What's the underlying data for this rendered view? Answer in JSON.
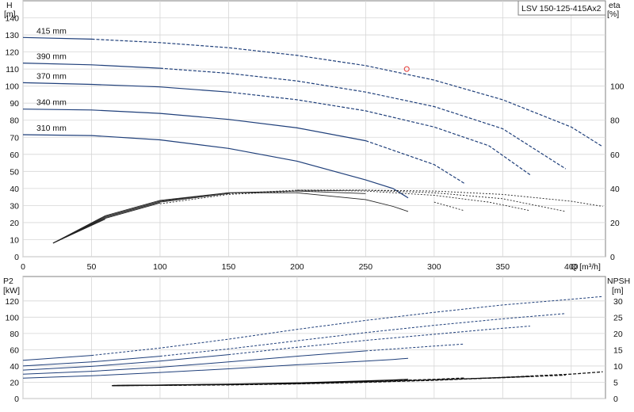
{
  "title_box": {
    "text": "LSV 150-125-415Ax2"
  },
  "colors": {
    "curve": "#1f3f7a",
    "efficiency": "#222222",
    "npsh": "#111111",
    "marker": "#e53935",
    "grid": "#d6d6d6",
    "frame": "#808080"
  },
  "chart_data": [
    {
      "type": "line",
      "panel": "head",
      "xlabel": "Q [m³/h]",
      "ylabel": "H",
      "ylabel_unit": "[m]",
      "y2label": "eta",
      "y2label_unit": "[%]",
      "xlim": [
        0,
        425
      ],
      "ylim": [
        0,
        150
      ],
      "y2lim": [
        0,
        150
      ],
      "xticks": [
        0,
        50,
        100,
        150,
        200,
        250,
        300,
        350,
        400
      ],
      "yticks": [
        0,
        10,
        20,
        30,
        40,
        50,
        60,
        70,
        80,
        90,
        100,
        110,
        120,
        130,
        140
      ],
      "y2ticks": [
        0,
        20,
        40,
        60,
        80,
        100
      ],
      "grid": true,
      "series": [
        {
          "name": "415 mm",
          "x": [
            0,
            50,
            100,
            150,
            200,
            250,
            300,
            350,
            400,
            423
          ],
          "y": [
            128.5,
            127.5,
            125.5,
            122.5,
            118,
            112,
            103.5,
            92,
            76,
            64.5
          ]
        },
        {
          "name": "390 mm",
          "x": [
            0,
            50,
            100,
            150,
            200,
            250,
            300,
            350,
            396
          ],
          "y": [
            113.5,
            112.5,
            110.5,
            107.5,
            103,
            96.5,
            88,
            75,
            51.5
          ]
        },
        {
          "name": "370 mm",
          "x": [
            0,
            50,
            100,
            150,
            200,
            250,
            300,
            340,
            370
          ],
          "y": [
            102,
            101,
            99.5,
            96.5,
            92,
            85.5,
            76,
            65,
            48
          ]
        },
        {
          "name": "340 mm",
          "x": [
            0,
            50,
            100,
            150,
            200,
            250,
            300,
            322
          ],
          "y": [
            86.5,
            86,
            84,
            80.5,
            75.5,
            68,
            54,
            43
          ]
        },
        {
          "name": "310 mm",
          "x": [
            0,
            50,
            100,
            150,
            200,
            250,
            270,
            281
          ],
          "y": [
            71.5,
            71,
            68.5,
            63.5,
            56,
            45,
            40,
            34.5
          ]
        }
      ],
      "efficiency_series": [
        {
          "x": [
            22,
            60,
            100,
            150,
            200,
            250,
            300,
            350,
            400,
            423
          ],
          "y": [
            8,
            22,
            31,
            36.5,
            38.5,
            39,
            38.5,
            36.5,
            32.5,
            29.5
          ]
        },
        {
          "x": [
            22,
            60,
            100,
            150,
            200,
            250,
            300,
            350,
            396
          ],
          "y": [
            8,
            22.5,
            31.5,
            37,
            39,
            39,
            37.5,
            34,
            26.5
          ]
        },
        {
          "x": [
            22,
            60,
            100,
            150,
            200,
            250,
            300,
            340,
            370
          ],
          "y": [
            8,
            23,
            32,
            37,
            39,
            38.5,
            36,
            32,
            27
          ]
        },
        {
          "x": [
            22,
            60,
            100,
            150,
            200,
            250,
            300,
            322
          ],
          "y": [
            8,
            23.5,
            32.5,
            37.5,
            38.5,
            37,
            32,
            27
          ]
        },
        {
          "x": [
            22,
            60,
            100,
            150,
            200,
            250,
            270,
            281
          ],
          "y": [
            8,
            24,
            33,
            37.5,
            37.5,
            33.5,
            29.5,
            26.5
          ]
        }
      ],
      "marker": {
        "x": 280,
        "y": 110
      }
    },
    {
      "type": "line",
      "panel": "power",
      "ylabel": "P2",
      "ylabel_unit": "[kW]",
      "y2label": "NPSH",
      "y2label_unit": "[m]",
      "xlim": [
        0,
        425
      ],
      "ylim": [
        0,
        150
      ],
      "y2lim": [
        0,
        37.5
      ],
      "yticks": [
        0,
        20,
        40,
        60,
        80,
        100,
        120
      ],
      "y2ticks": [
        0,
        5,
        10,
        15,
        20,
        25,
        30
      ],
      "grid": true,
      "series": [
        {
          "name": "415 mm",
          "x": [
            0,
            50,
            100,
            150,
            200,
            250,
            300,
            350,
            400,
            423
          ],
          "y": [
            47,
            53,
            62,
            73,
            85,
            96,
            106,
            115,
            122,
            125.5
          ]
        },
        {
          "name": "390 mm",
          "x": [
            0,
            50,
            100,
            150,
            200,
            250,
            300,
            350,
            396
          ],
          "y": [
            40,
            45,
            52,
            61,
            71,
            81,
            90,
            98,
            104.5
          ]
        },
        {
          "name": "370 mm",
          "x": [
            0,
            50,
            100,
            150,
            200,
            250,
            300,
            340,
            370
          ],
          "y": [
            35,
            39.5,
            46,
            54,
            63,
            71.5,
            79,
            85,
            89
          ]
        },
        {
          "name": "340 mm",
          "x": [
            0,
            50,
            100,
            150,
            200,
            250,
            300,
            322
          ],
          "y": [
            30,
            33.5,
            38.5,
            45,
            52,
            58.5,
            64.5,
            67
          ]
        },
        {
          "name": "310 mm",
          "x": [
            0,
            50,
            100,
            150,
            200,
            250,
            270,
            281
          ],
          "y": [
            25,
            28,
            32,
            36.5,
            41.5,
            46,
            48,
            49.5
          ]
        }
      ],
      "npsh_series": [
        {
          "x": [
            65,
            100,
            150,
            200,
            250,
            300,
            350,
            400,
            423
          ],
          "y": [
            4,
            4.05,
            4.2,
            4.5,
            5,
            5.6,
            6.5,
            7.5,
            8.2
          ]
        },
        {
          "x": [
            65,
            100,
            150,
            200,
            250,
            300,
            350,
            396
          ],
          "y": [
            4,
            4.1,
            4.25,
            4.55,
            5.05,
            5.7,
            6.4,
            7.2
          ]
        },
        {
          "x": [
            65,
            100,
            150,
            200,
            250,
            300,
            340,
            370
          ],
          "y": [
            4,
            4.1,
            4.3,
            4.6,
            5.15,
            5.8,
            6.3,
            6.8
          ]
        },
        {
          "x": [
            65,
            100,
            150,
            200,
            250,
            300,
            322
          ],
          "y": [
            4,
            4.1,
            4.35,
            4.7,
            5.25,
            5.9,
            6.3
          ]
        },
        {
          "x": [
            65,
            100,
            150,
            200,
            250,
            270,
            281
          ],
          "y": [
            4,
            4.15,
            4.4,
            4.8,
            5.4,
            5.7,
            5.9
          ]
        }
      ]
    }
  ]
}
